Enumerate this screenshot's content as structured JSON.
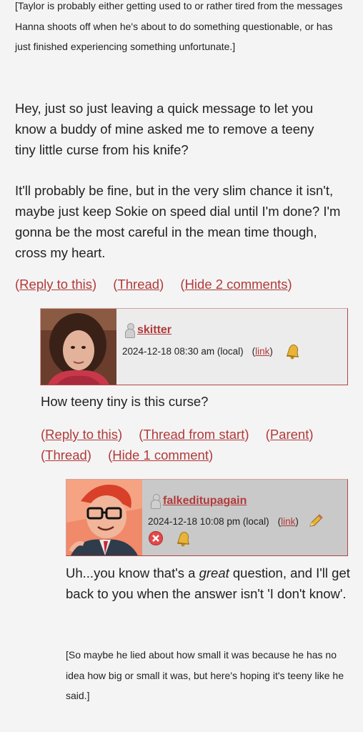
{
  "entry": {
    "note": "[Taylor is probably either getting used to or rather tired from the messages Hanna shoots off when he's about to do something questionable, or has just finished experiencing something unfortunate.]",
    "paragraph1": "Hey, just so just leaving a quick message to let you know a buddy of mine asked me to remove a teeny tiny little curse from his knife?",
    "paragraph2": "It'll probably be fine, but in the very slim chance it isn't, maybe just keep Sokie on speed dial until I'm done? I'm gonna be the most careful in the mean time though, cross my heart.",
    "links": {
      "reply": "Reply to this",
      "thread": "Thread",
      "hide": "Hide 2 comments"
    }
  },
  "comment1": {
    "username": "skitter",
    "date": "2024-12-18 08:30 am (local)",
    "link_label": "link",
    "text": "How teeny tiny is this curse?",
    "links": {
      "reply": "Reply to this",
      "thread_start": "Thread from start",
      "parent": "Parent",
      "thread": "Thread",
      "hide": "Hide 1 comment"
    }
  },
  "comment2": {
    "username": "falkeditupagain",
    "date": "2024-12-18 10:08 pm (local)",
    "link_label": "link",
    "text_before": "Uh...you know that's a ",
    "text_emph": "great",
    "text_after": " question, and I'll get back to you when the answer isn't 'I don't know'.",
    "note": "[So maybe he lied about how small it was because he has no idea how big or small it was, but here's hoping it's teeny like he said.]"
  },
  "icons": {
    "user": "user-icon",
    "bell": "bell-icon",
    "edit": "pencil-edit-icon",
    "delete": "delete-icon"
  },
  "colors": {
    "link": "#b23a3a",
    "background": "#f4f4f4",
    "header_bg_1": "#e9e9e9",
    "header_bg_2": "#c8c8c8"
  }
}
